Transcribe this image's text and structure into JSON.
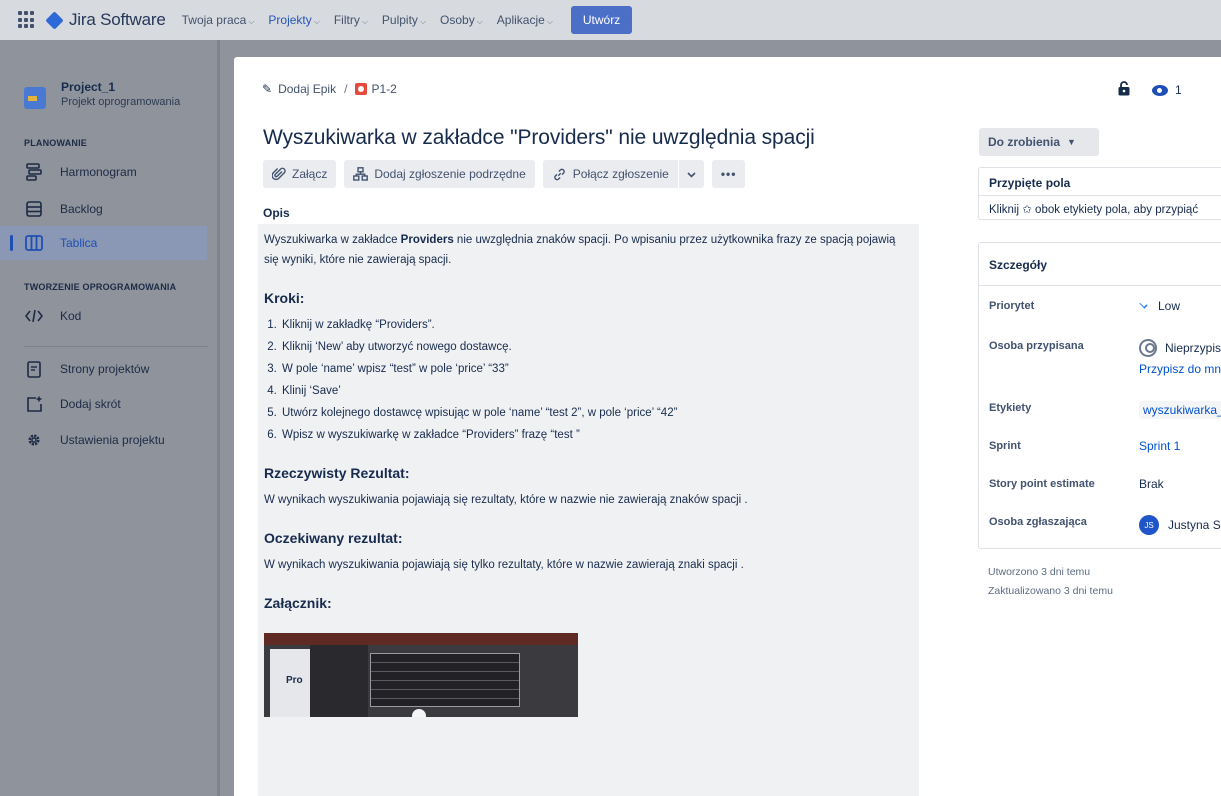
{
  "topnav": {
    "brand": "Jira Software",
    "items": [
      {
        "label": "Twoja praca",
        "active": false
      },
      {
        "label": "Projekty",
        "active": true
      },
      {
        "label": "Filtry",
        "active": false
      },
      {
        "label": "Pulpity",
        "active": false
      },
      {
        "label": "Osoby",
        "active": false
      },
      {
        "label": "Aplikacje",
        "active": false
      }
    ],
    "create_label": "Utwórz"
  },
  "sidebar": {
    "project_name": "Project_1",
    "project_type": "Projekt oprogramowania",
    "section_planning": "PLANOWANIE",
    "section_dev": "TWORZENIE OPROGRAMOWANIA",
    "items": [
      {
        "label": "Harmonogram",
        "icon": "timeline-icon"
      },
      {
        "label": "Backlog",
        "icon": "backlog-icon"
      },
      {
        "label": "Tablica",
        "icon": "board-icon",
        "active": true
      },
      {
        "label": "Kod",
        "icon": "code-icon"
      },
      {
        "label": "Strony projektów",
        "icon": "pages-icon"
      },
      {
        "label": "Dodaj skrót",
        "icon": "add-shortcut-icon"
      },
      {
        "label": "Ustawienia projektu",
        "icon": "settings-icon"
      }
    ]
  },
  "issue": {
    "breadcrumb_epic": "Dodaj Epik",
    "breadcrumb_sep": "/",
    "key": "P1-2",
    "watchers": "1",
    "title": "Wyszukiwarka w zakładce \"Providers\" nie uwzględnia spacji",
    "actions": {
      "attach": "Załącz",
      "add_child": "Dodaj zgłoszenie podrzędne",
      "link_issue": "Połącz zgłoszenie",
      "more": "•••"
    },
    "description_heading": "Opis",
    "description": {
      "intro_before": "Wyszukiwarka w zakładce ",
      "intro_bold": "Providers",
      "intro_after": " nie uwzględnia znaków spacji. Po wpisaniu przez użytkownika frazy ze spacją pojawią się wyniki, które nie zawierają spacji.",
      "steps_heading": "Kroki:",
      "steps": [
        "Kliknij w zakładkę “Providers”.",
        "Kliknij ‘New’ aby utworzyć nowego dostawcę.",
        "W pole ‘name’ wpisz “test” w pole ‘price’ “33”",
        "Klinij ‘Save’",
        "Utwórz kolejnego dostawcę wpisując w pole ‘name’ “test 2”, w pole ‘price’ “42”",
        "Wpisz w wyszukiwarkę w zakładce “Providers” frazę “test ”"
      ],
      "actual_heading": "Rzeczywisty Rezultat:",
      "actual_text": "W wynikach wyszukiwania pojawiają się rezultaty, które w nazwie nie zawierają znaków spacji .",
      "expected_heading": "Oczekiwany rezultat:",
      "expected_text": "W wynikach wyszukiwania pojawiają się tylko rezultaty, które w nazwie zawierają znaki spacji .",
      "attachment_heading": "Załącznik:",
      "attachment_thumb_text": "Pro"
    }
  },
  "right": {
    "status": "Do zrobienia",
    "pinned_heading": "Przypięte pola",
    "pinned_hint": "Kliknij ✩ obok etykiety pola, aby przypiąć",
    "details_heading": "Szczegóły",
    "fields": {
      "priority_label": "Priorytet",
      "priority_value": "Low",
      "assignee_label": "Osoba przypisana",
      "assignee_value": "Nieprzypisane",
      "assign_to_me": "Przypisz do mnie",
      "labels_label": "Etykiety",
      "labels_value": "wyszukiwarka_",
      "sprint_label": "Sprint",
      "sprint_value": "Sprint 1",
      "estimate_label": "Story point estimate",
      "estimate_value": "Brak",
      "reporter_label": "Osoba zgłaszająca",
      "reporter_initials": "JS",
      "reporter_value": "Justyna S"
    },
    "created": "Utworzono 3 dni temu",
    "updated": "Zaktualizowano 3 dni temu"
  },
  "colors": {
    "accent": "#0052cc",
    "priority_low": "#2684ff",
    "bug": "#e5493a"
  }
}
